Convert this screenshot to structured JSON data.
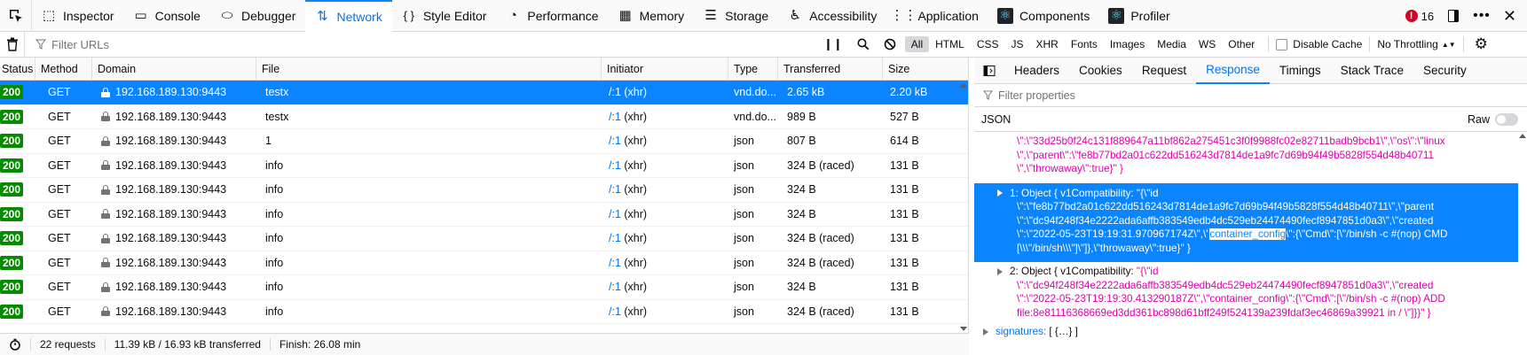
{
  "toolbar": {
    "tabs": [
      {
        "label": "Inspector",
        "icon": "inspector-icon"
      },
      {
        "label": "Console",
        "icon": "console-icon"
      },
      {
        "label": "Debugger",
        "icon": "debugger-icon"
      },
      {
        "label": "Network",
        "icon": "network-icon",
        "active": true
      },
      {
        "label": "Style Editor",
        "icon": "braces-icon"
      },
      {
        "label": "Performance",
        "icon": "gauge-icon"
      },
      {
        "label": "Memory",
        "icon": "chip-icon"
      },
      {
        "label": "Storage",
        "icon": "storage-icon"
      },
      {
        "label": "Accessibility",
        "icon": "accessibility-icon"
      },
      {
        "label": "Application",
        "icon": "grid-icon"
      },
      {
        "label": "Components",
        "icon": "react-icon"
      },
      {
        "label": "Profiler",
        "icon": "react-icon"
      }
    ],
    "error_count": "16"
  },
  "filterbar": {
    "url_placeholder": "Filter URLs",
    "types": [
      "All",
      "HTML",
      "CSS",
      "JS",
      "XHR",
      "Fonts",
      "Images",
      "Media",
      "WS",
      "Other"
    ],
    "active_type": "All",
    "disable_cache_label": "Disable Cache",
    "throttle_label": "No Throttling"
  },
  "table": {
    "columns": [
      "Status",
      "Method",
      "Domain",
      "File",
      "Initiator",
      "Type",
      "Transferred",
      "Size"
    ],
    "rows": [
      {
        "status": "200",
        "method": "GET",
        "domain": "192.168.189.130:9443",
        "file": "testx",
        "initiator_link": "/:1",
        "initiator_kind": "(xhr)",
        "type": "vnd.do...",
        "transferred": "2.65 kB",
        "size": "2.20 kB",
        "selected": true
      },
      {
        "status": "200",
        "method": "GET",
        "domain": "192.168.189.130:9443",
        "file": "testx",
        "initiator_link": "/:1",
        "initiator_kind": "(xhr)",
        "type": "vnd.do...",
        "transferred": "989 B",
        "size": "527 B"
      },
      {
        "status": "200",
        "method": "GET",
        "domain": "192.168.189.130:9443",
        "file": "1",
        "initiator_link": "/:1",
        "initiator_kind": "(xhr)",
        "type": "json",
        "transferred": "807 B",
        "size": "614 B"
      },
      {
        "status": "200",
        "method": "GET",
        "domain": "192.168.189.130:9443",
        "file": "info",
        "initiator_link": "/:1",
        "initiator_kind": "(xhr)",
        "type": "json",
        "transferred": "324 B (raced)",
        "size": "131 B"
      },
      {
        "status": "200",
        "method": "GET",
        "domain": "192.168.189.130:9443",
        "file": "info",
        "initiator_link": "/:1",
        "initiator_kind": "(xhr)",
        "type": "json",
        "transferred": "324 B",
        "size": "131 B"
      },
      {
        "status": "200",
        "method": "GET",
        "domain": "192.168.189.130:9443",
        "file": "info",
        "initiator_link": "/:1",
        "initiator_kind": "(xhr)",
        "type": "json",
        "transferred": "324 B",
        "size": "131 B"
      },
      {
        "status": "200",
        "method": "GET",
        "domain": "192.168.189.130:9443",
        "file": "info",
        "initiator_link": "/:1",
        "initiator_kind": "(xhr)",
        "type": "json",
        "transferred": "324 B (raced)",
        "size": "131 B"
      },
      {
        "status": "200",
        "method": "GET",
        "domain": "192.168.189.130:9443",
        "file": "info",
        "initiator_link": "/:1",
        "initiator_kind": "(xhr)",
        "type": "json",
        "transferred": "324 B (raced)",
        "size": "131 B"
      },
      {
        "status": "200",
        "method": "GET",
        "domain": "192.168.189.130:9443",
        "file": "info",
        "initiator_link": "/:1",
        "initiator_kind": "(xhr)",
        "type": "json",
        "transferred": "324 B",
        "size": "131 B"
      },
      {
        "status": "200",
        "method": "GET",
        "domain": "192.168.189.130:9443",
        "file": "info",
        "initiator_link": "/:1",
        "initiator_kind": "(xhr)",
        "type": "json",
        "transferred": "324 B (raced)",
        "size": "131 B"
      }
    ]
  },
  "statusbar": {
    "requests": "22 requests",
    "transferred": "11.39 kB / 16.93 kB transferred",
    "finish": "Finish: 26.08 min"
  },
  "side": {
    "tabs": [
      "Headers",
      "Cookies",
      "Request",
      "Response",
      "Timings",
      "Stack Trace",
      "Security"
    ],
    "active_tab": "Response",
    "filter_placeholder": "Filter properties",
    "json_label": "JSON",
    "raw_label": "Raw",
    "json": {
      "top_lines": [
        "\\\":\\\"33d25b0f24c131f889647a11bf862a275451c3f0f9988fc02e82711badb9bcb1\\\",\\\"os\\\":\\\"linux",
        "\\\",\\\"parent\\\":\\\"fe8b77bd2a01c622dd516243d7814de1a9fc7d69b94f49b5828f554d48b40711",
        "\\\",\\\"throwaway\\\":true}\" }"
      ],
      "obj1_head": "1: Object { v1Compatibility: ",
      "obj1_first": "\"{\\\"id",
      "obj1_lines": [
        "\\\":\\\"fe8b77bd2a01c622dd516243d7814de1a9fc7d69b94f49b5828f554d48b40711\\\",\\\"parent",
        "\\\":\\\"dc94f248f34e2222ada6affb383549edb4dc529eb24474490fecf8947851d0a3\\\",\\\"created"
      ],
      "obj1_line_pre": "\\\":\\\"2022-05-23T19:19:31.970967174Z\\\",\\\"",
      "obj1_highlight": "container_config",
      "obj1_line_post": "\\\":{\\\"Cmd\\\":[\\\"/bin/sh -c #(nop) CMD",
      "obj1_last": "[\\\\\\\"/bin/sh\\\\\\\"]\\\"]},\\\"throwaway\\\":true}\" }",
      "obj2_head": "2: Object { v1Compatibility: ",
      "obj2_first": "\"{\\\"id",
      "obj2_lines": [
        "\\\":\\\"dc94f248f34e2222ada6affb383549edb4dc529eb24474490fecf8947851d0a3\\\",\\\"created",
        "\\\":\\\"2022-05-23T19:19:30.413290187Z\\\",\\\"container_config\\\":{\\\"Cmd\\\":[\\\"/bin/sh -c #(nop) ADD",
        "file:8e81116368669ed3dd361bc898d61bff249f524139a239fdaf3ec46869a39921 in / \\\"]}}\" }"
      ],
      "signatures_label": "signatures: ",
      "signatures_value": "[ {…} ]"
    }
  }
}
